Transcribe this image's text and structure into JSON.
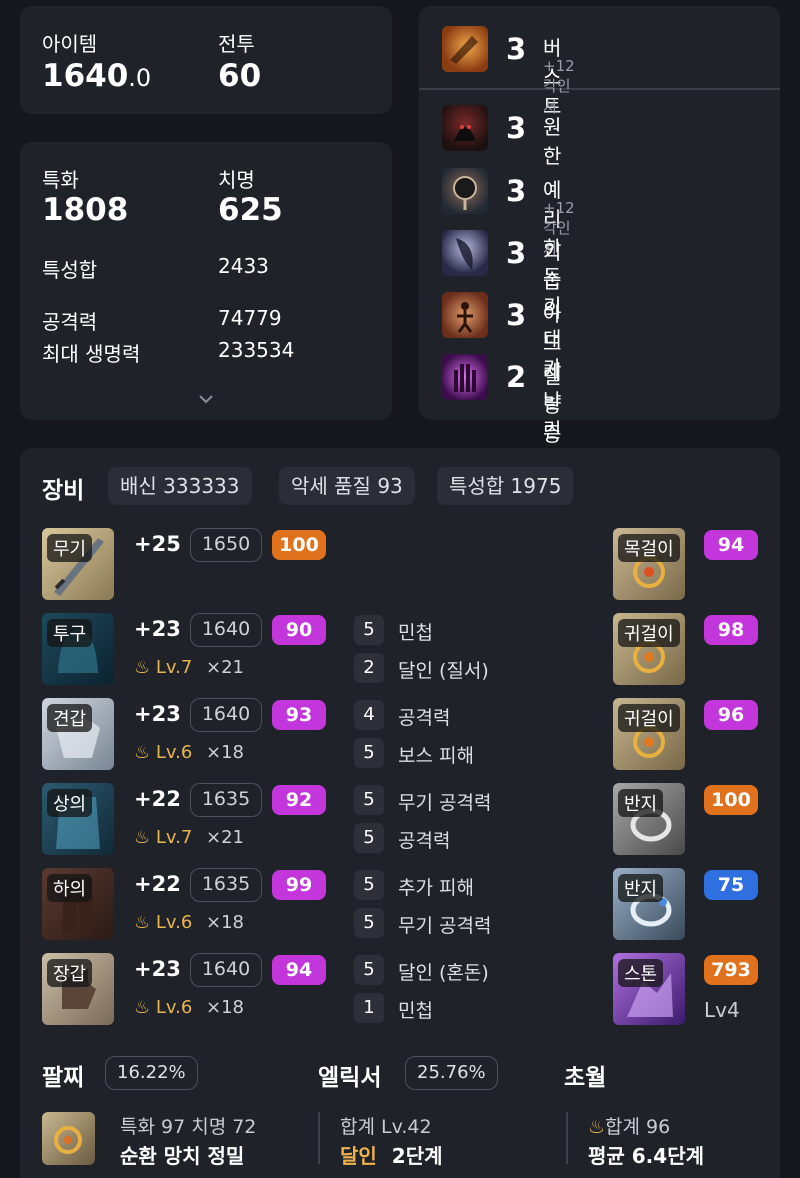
{
  "stats_top": {
    "item_label": "아이템",
    "item_value": "1640",
    "item_decimal": ".0",
    "combat_label": "전투",
    "combat_value": "60"
  },
  "stats": {
    "spec_label": "특화",
    "spec_value": "1808",
    "crit_label": "치명",
    "crit_value": "625",
    "total_label": "특성합",
    "total_value": "2433",
    "atk_label": "공격력",
    "atk_value": "74779",
    "hp_label": "최대 생명력",
    "hp_value": "233534"
  },
  "engravings": [
    {
      "level": "3",
      "name": "버스트",
      "sub": "+12 각인서",
      "icon": "burst-engraving-icon",
      "color": "#c96a28"
    },
    {
      "level": "3",
      "name": "원한",
      "sub": "",
      "icon": "grudge-engraving-icon",
      "color": "#5a2a2a"
    },
    {
      "level": "3",
      "name": "예리한 둔기",
      "sub": "+12 각인서",
      "icon": "keen-blunt-engraving-icon",
      "color": "#3a4856"
    },
    {
      "level": "3",
      "name": "기습의 대가",
      "sub": "",
      "icon": "master-ambush-engraving-icon",
      "color": "#3c3a5c"
    },
    {
      "level": "3",
      "name": "아드레날린",
      "sub": "",
      "icon": "adrenaline-engraving-icon",
      "color": "#a4593a"
    },
    {
      "level": "2",
      "name": "질량 증가",
      "sub": "",
      "icon": "mass-increase-engraving-icon",
      "color": "#7a2a9a"
    }
  ],
  "equipment": {
    "title": "장비",
    "chips": [
      "배신 333333",
      "악세 품질 93",
      "특성합 1975"
    ],
    "gear": [
      {
        "slot": "무기",
        "plus": "+25",
        "level": "1650",
        "quality": "100",
        "qcolor": "orange",
        "elixir_lv": "",
        "elixir_mult": "",
        "stats": []
      },
      {
        "slot": "투구",
        "plus": "+23",
        "level": "1640",
        "quality": "90",
        "qcolor": "purple",
        "elixir_lv": "Lv.7",
        "elixir_mult": "×21",
        "stats": [
          {
            "n": "5",
            "name": "민첩"
          },
          {
            "n": "2",
            "name": "달인 (질서)"
          }
        ]
      },
      {
        "slot": "견갑",
        "plus": "+23",
        "level": "1640",
        "quality": "93",
        "qcolor": "purple",
        "elixir_lv": "Lv.6",
        "elixir_mult": "×18",
        "stats": [
          {
            "n": "4",
            "name": "공격력"
          },
          {
            "n": "5",
            "name": "보스 피해"
          }
        ]
      },
      {
        "slot": "상의",
        "plus": "+22",
        "level": "1635",
        "quality": "92",
        "qcolor": "purple",
        "elixir_lv": "Lv.7",
        "elixir_mult": "×21",
        "stats": [
          {
            "n": "5",
            "name": "무기 공격력"
          },
          {
            "n": "5",
            "name": "공격력"
          }
        ]
      },
      {
        "slot": "하의",
        "plus": "+22",
        "level": "1635",
        "quality": "99",
        "qcolor": "purple",
        "elixir_lv": "Lv.6",
        "elixir_mult": "×18",
        "stats": [
          {
            "n": "5",
            "name": "추가 피해"
          },
          {
            "n": "5",
            "name": "무기 공격력"
          }
        ]
      },
      {
        "slot": "장갑",
        "plus": "+23",
        "level": "1640",
        "quality": "94",
        "qcolor": "purple",
        "elixir_lv": "Lv.6",
        "elixir_mult": "×18",
        "stats": [
          {
            "n": "5",
            "name": "달인 (혼돈)"
          },
          {
            "n": "1",
            "name": "민첩"
          }
        ]
      }
    ],
    "accessories": [
      {
        "slot": "목걸이",
        "quality": "94",
        "qcolor": "purple",
        "extra": ""
      },
      {
        "slot": "귀걸이",
        "quality": "98",
        "qcolor": "purple",
        "extra": ""
      },
      {
        "slot": "귀걸이",
        "quality": "96",
        "qcolor": "purple",
        "extra": ""
      },
      {
        "slot": "반지",
        "quality": "100",
        "qcolor": "orange",
        "extra": ""
      },
      {
        "slot": "반지",
        "quality": "75",
        "qcolor": "blue",
        "extra": ""
      },
      {
        "slot": "스톤",
        "quality": "793",
        "qcolor": "orange",
        "extra": "Lv4"
      }
    ]
  },
  "bottom": {
    "bracelet_label": "팔찌",
    "bracelet_pct": "16.22%",
    "elixir_label": "엘릭서",
    "elixir_pct": "25.76%",
    "transcend_label": "초월",
    "bracelet_line1": "특화 97  치명 72",
    "bracelet_line2": "순환  망치  정밀",
    "elixir_line1": "합계 Lv.42",
    "elixir_highlight": "달인",
    "elixir_line2": "2단계",
    "transcend_line1": "합계 96",
    "transcend_line2": "평균 6.4단계"
  },
  "colors": {
    "purple": "#c236dc",
    "orange": "#e0711d",
    "blue": "#2f6fe0",
    "gold": "#e7b64f"
  }
}
